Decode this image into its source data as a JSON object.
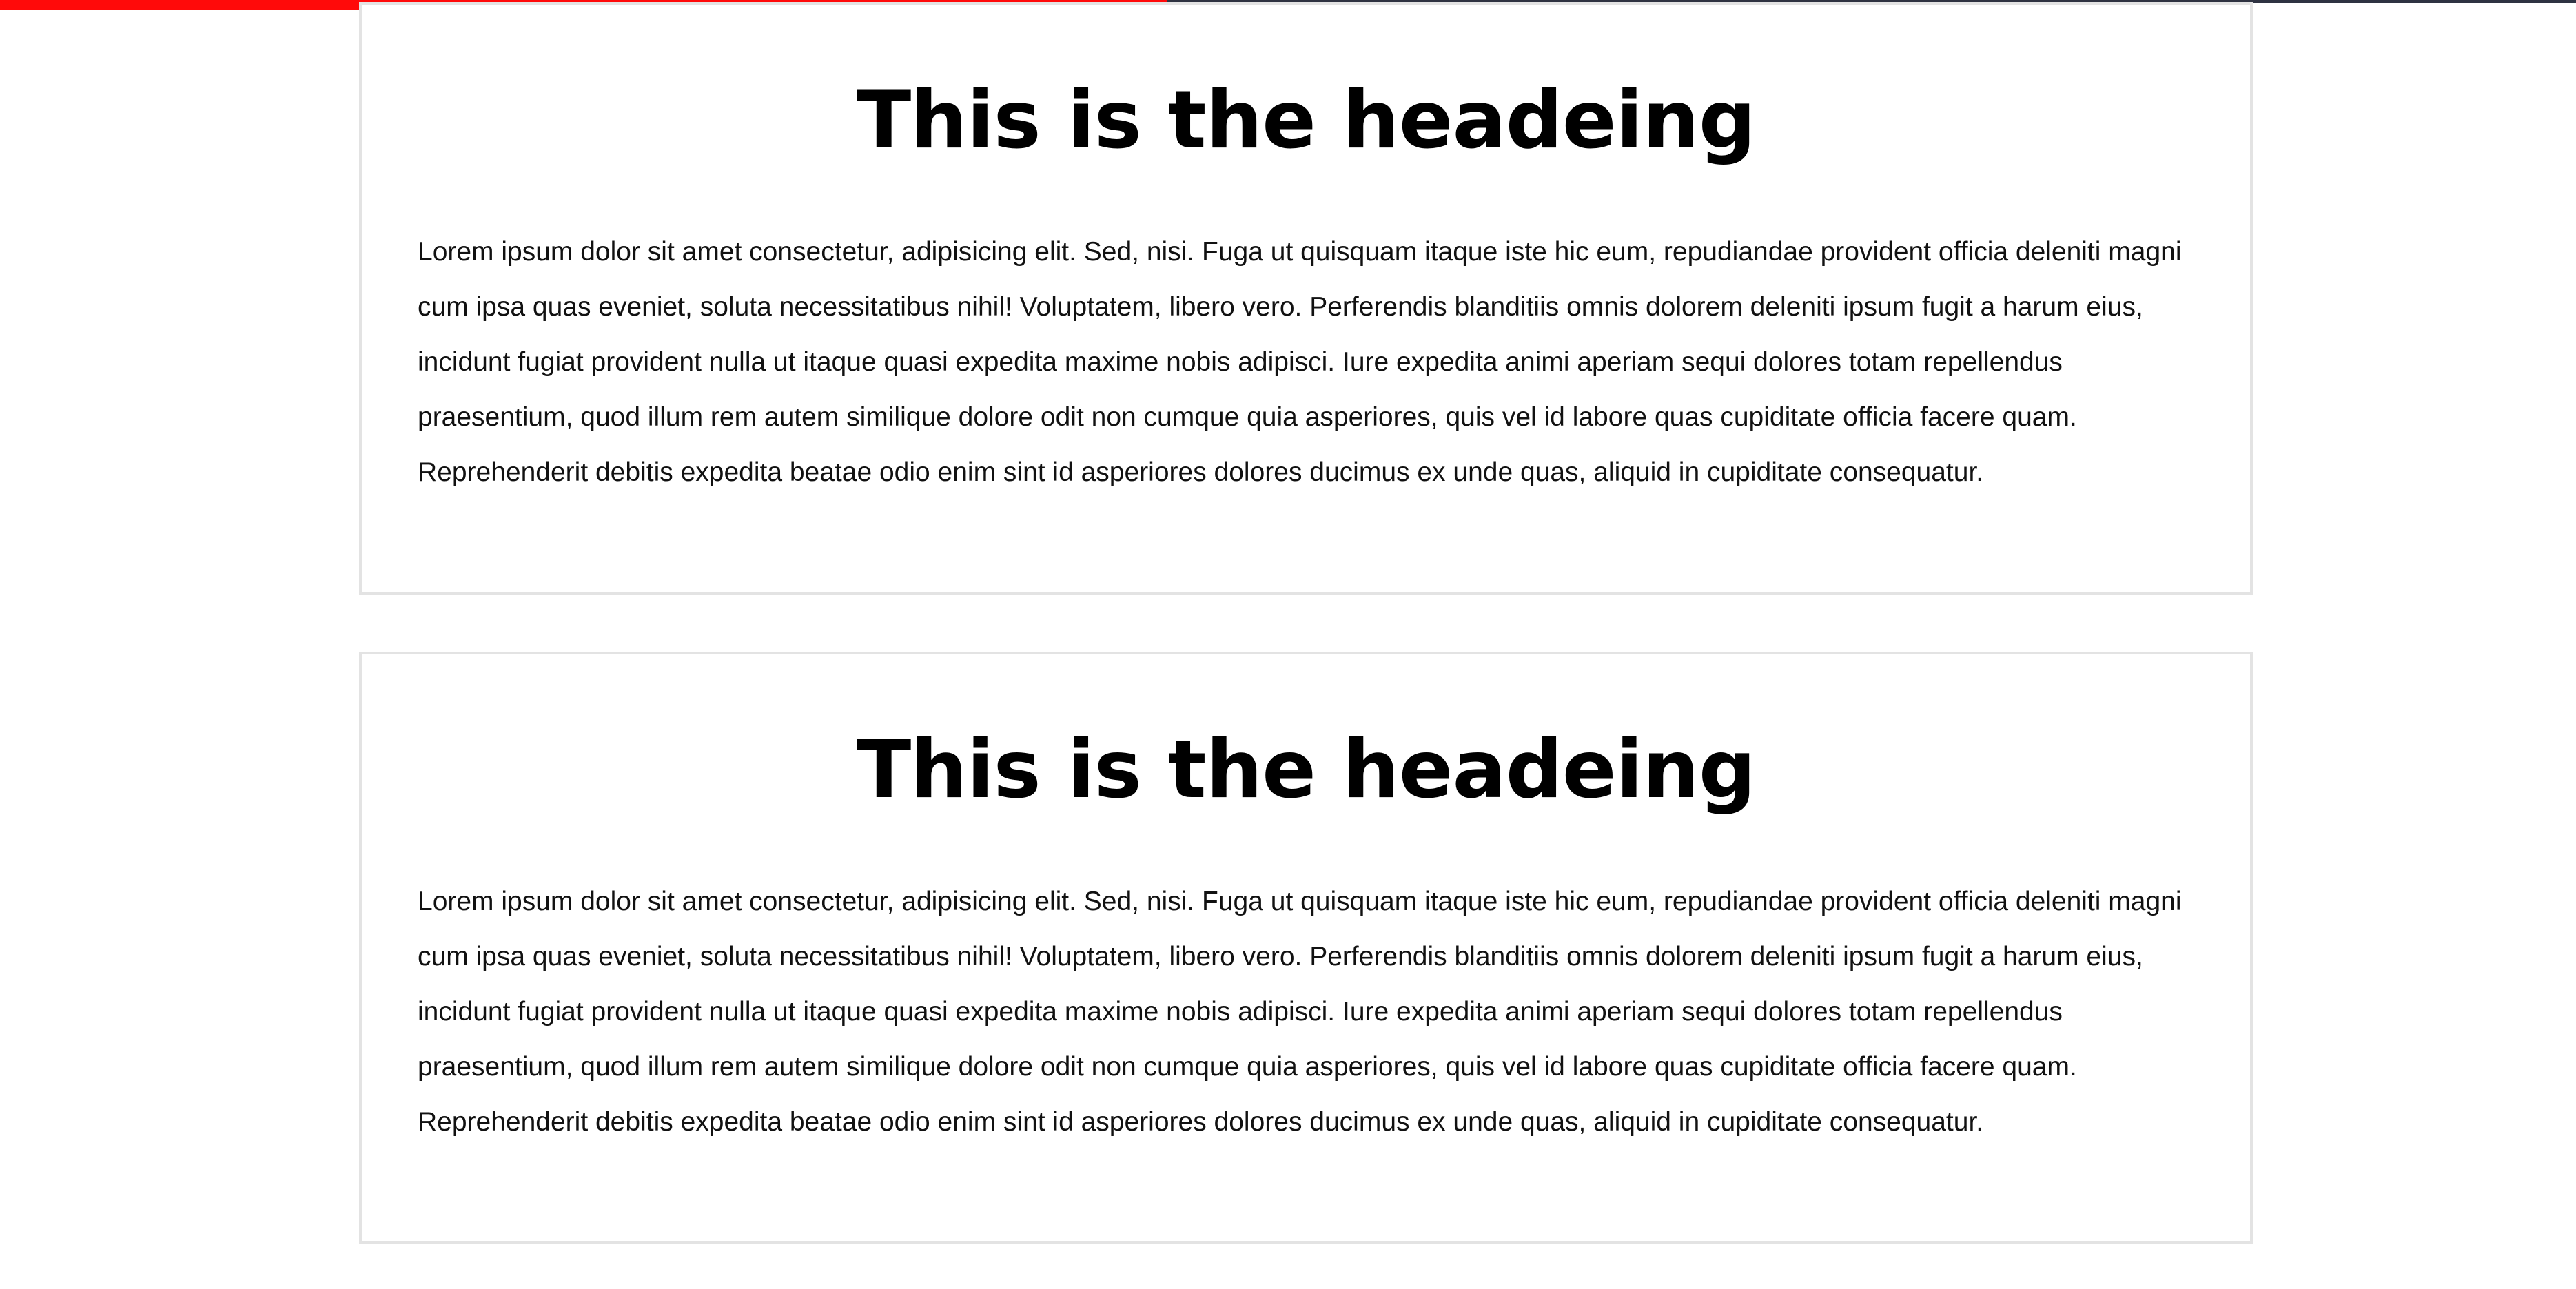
{
  "scroll_progress": {
    "fraction": 0.453,
    "fill_color": "#ff0a0a",
    "track_color": "#2f3342"
  },
  "articles": [
    {
      "heading": "This is the headeing",
      "body": "Lorem ipsum dolor sit amet consectetur, adipisicing elit. Sed, nisi. Fuga ut quisquam itaque iste hic eum, repudiandae provident officia deleniti magni cum ipsa quas eveniet, soluta necessitatibus nihil! Voluptatem, libero vero. Perferendis blanditiis omnis dolorem deleniti ipsum fugit a harum eius, incidunt fugiat provident nulla ut itaque quasi expedita maxime nobis adipisci. Iure expedita animi aperiam sequi dolores totam repellendus praesentium, quod illum rem autem similique dolore odit non cumque quia asperiores, quis vel id labore quas cupiditate officia facere quam. Reprehenderit debitis expedita beatae odio enim sint id asperiores dolores ducimus ex unde quas, aliquid in cupiditate consequatur."
    },
    {
      "heading": "This is the headeing",
      "body": "Lorem ipsum dolor sit amet consectetur, adipisicing elit. Sed, nisi. Fuga ut quisquam itaque iste hic eum, repudiandae provident officia deleniti magni cum ipsa quas eveniet, soluta necessitatibus nihil! Voluptatem, libero vero. Perferendis blanditiis omnis dolorem deleniti ipsum fugit a harum eius, incidunt fugiat provident nulla ut itaque quasi expedita maxime nobis adipisci. Iure expedita animi aperiam sequi dolores totam repellendus praesentium, quod illum rem autem similique dolore odit non cumque quia asperiores, quis vel id labore quas cupiditate officia facere quam. Reprehenderit debitis expedita beatae odio enim sint id asperiores dolores ducimus ex unde quas, aliquid in cupiditate consequatur."
    }
  ]
}
